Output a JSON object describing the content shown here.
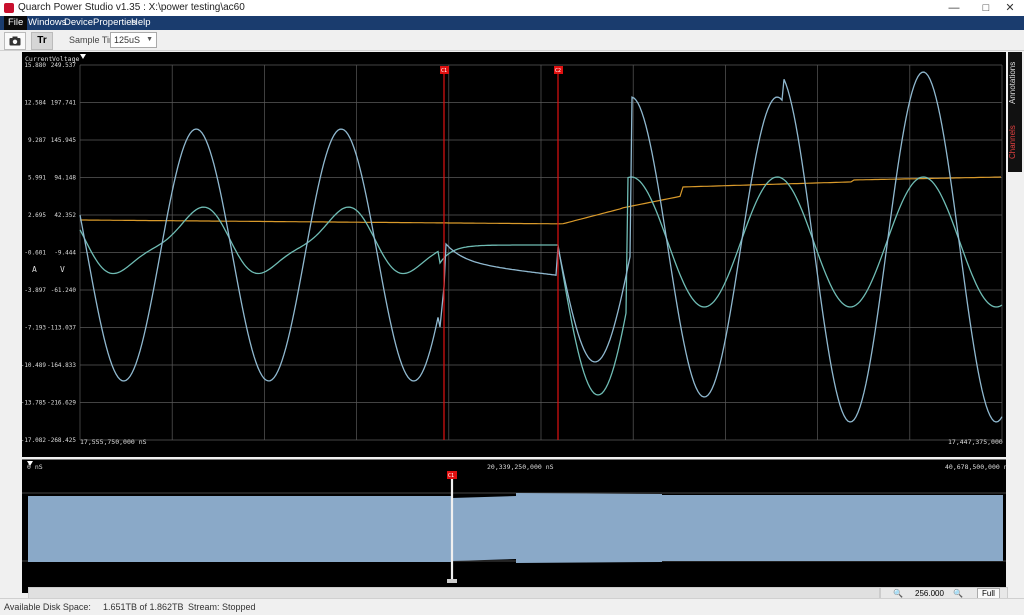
{
  "window": {
    "title": "Quarch Power Studio v1.35 : X:\\power testing\\ac60",
    "minimize": "—",
    "maximize": "□",
    "close": "✕"
  },
  "menu": [
    "File",
    "Windows",
    "Device",
    "Properties",
    "Help"
  ],
  "toolbar": {
    "camera_icon": "camera-icon",
    "text_button": "Tr",
    "sample_time_label": "Sample Time:",
    "sample_time_value": "125uS"
  },
  "main_chart": {
    "col_current": "Current",
    "col_voltage": "Voltage",
    "current_ticks": [
      "15.880",
      "12.584",
      "9.287",
      "5.991",
      "2.695",
      "-0.601",
      "-3.897",
      "-7.193",
      "-10.489",
      "-13.785",
      "-17.082"
    ],
    "voltage_ticks": [
      "249.537",
      "197.741",
      "145.945",
      "94.148",
      "42.352",
      "-9.444",
      "-61.240",
      "-113.037",
      "-164.833",
      "-216.629",
      "-268.425"
    ],
    "unit_current": "A",
    "unit_voltage": "V",
    "x_start": "17,555,750,000 nS",
    "x_end": "17,447,375,000 nS",
    "cursor1": "C1",
    "cursor2": "C2",
    "colors": {
      "voltage": "#8fb8cf",
      "current": "#6fbcb4",
      "power": "#d99a2b",
      "cursor": "#e01010",
      "grid": "#5a5a5a"
    }
  },
  "overview": {
    "x_start": "0 nS",
    "x_mid": "20,339,250,000 nS",
    "x_end": "40,678,500,000 nS",
    "cursor": "C1",
    "fill_color": "#8aa9c8"
  },
  "side_tabs": {
    "channels": "Channels",
    "annotations": "Annotations"
  },
  "zoom": {
    "level": "256.000",
    "full": "Full"
  },
  "status": {
    "disk_label": "Available Disk Space:",
    "disk_value": "1.651TB of 1.862TB",
    "stream_label": "Stream:",
    "stream_value": "Stopped"
  }
}
